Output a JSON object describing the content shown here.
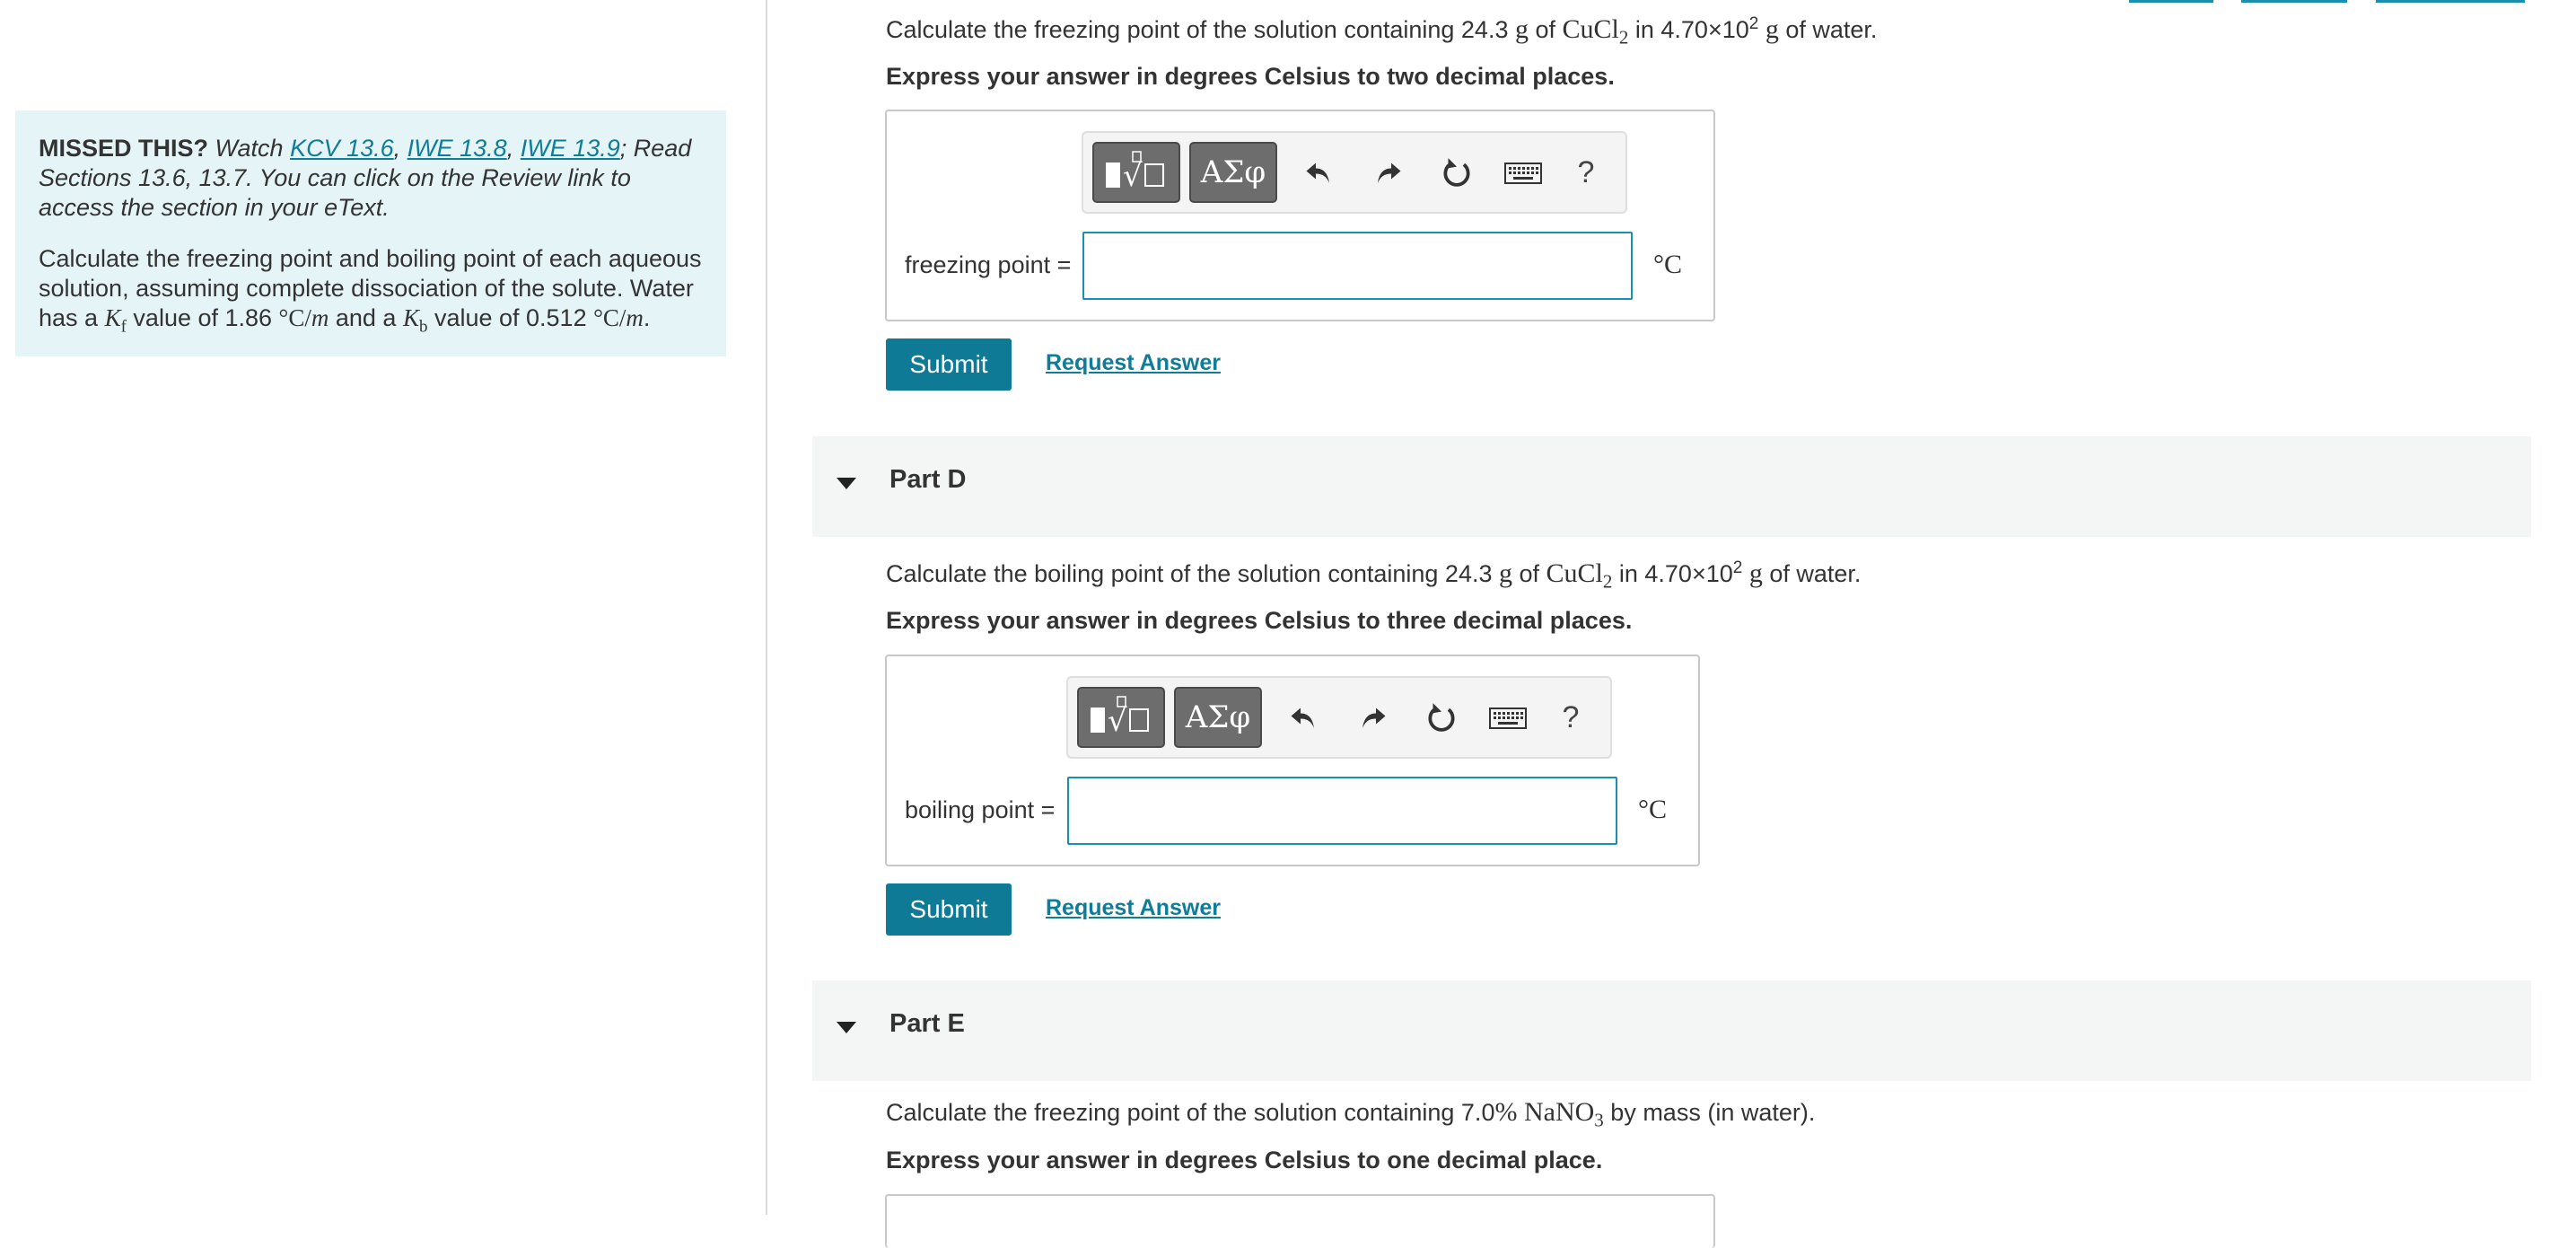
{
  "sidebar": {
    "missed_label": "MISSED THIS?",
    "watch_text": " Watch ",
    "links": [
      "KCV 13.6",
      "IWE 13.8",
      "IWE 13.9"
    ],
    "sep": ", ",
    "read_text": "; Read Sections 13.6, 13.7. You can click on the Review link to access the section in your eText.",
    "intro_text": "Calculate the freezing point and boiling point of each aqueous solution, assuming complete dissociation of the solute. Water has a",
    "kf_symbol": "K",
    "kf_sub": "f",
    "kf_text": " value of 1.86 ",
    "unit_cm": "°C/",
    "unit_m": "m",
    "and_text": " and a ",
    "kb_symbol": "K",
    "kb_sub": "b",
    "kb_text": " value of 0.512 ",
    "period": "."
  },
  "part_c": {
    "q_pre": "Calculate the freezing point of the solution containing 24.3 ",
    "q_g1": "g",
    "q_of": " of ",
    "q_solute": "CuCl",
    "q_solute_sub": "2",
    "q_in": " in 4.70×10",
    "q_exp": "2",
    "q_g2": " g",
    "q_post": " of water.",
    "instruction": "Express your answer in degrees Celsius to two decimal places.",
    "field_label": "freezing point =",
    "unit": "°C",
    "submit": "Submit",
    "request": "Request Answer"
  },
  "part_d": {
    "title": "Part D",
    "q_pre": "Calculate the boiling point of the solution containing 24.3 ",
    "q_g1": "g",
    "q_of": " of ",
    "q_solute": "CuCl",
    "q_solute_sub": "2",
    "q_in": " in 4.70×10",
    "q_exp": "2",
    "q_g2": " g",
    "q_post": " of water.",
    "instruction": "Express your answer in degrees Celsius to three decimal places.",
    "field_label": "boiling point =",
    "unit": "°C",
    "submit": "Submit",
    "request": "Request Answer"
  },
  "part_e": {
    "title": "Part E",
    "q_pre": "Calculate the freezing point of the solution containing 7.0",
    "q_pct": "%",
    "q_sp": " ",
    "q_solute": "NaNO",
    "q_solute_sub": "3",
    "q_post": " by mass (in water).",
    "instruction": "Express your answer in degrees Celsius to one decimal place."
  },
  "toolbar": {
    "templates_icon": "templates-icon",
    "greek_label": "ΑΣφ",
    "undo_icon": "undo-icon",
    "redo_icon": "redo-icon",
    "reset_icon": "reset-icon",
    "keyboard_icon": "keyboard-icon",
    "help_label": "?"
  },
  "colors": {
    "accent": "#0e7a96",
    "link": "#0f7c98",
    "panel_bg": "#e5f4f6",
    "part_header_bg": "#f4f5f5"
  }
}
